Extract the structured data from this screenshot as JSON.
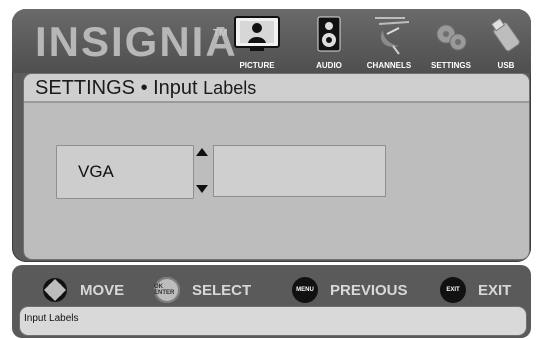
{
  "brand": {
    "logo_text": "INSIGNIA",
    "trademark": "TM"
  },
  "menu": {
    "tabs": [
      {
        "label": "PICTURE",
        "icon": "tv-anchor-icon"
      },
      {
        "label": "AUDIO",
        "icon": "speaker-icon"
      },
      {
        "label": "CHANNELS",
        "icon": "satellite-dish-icon"
      },
      {
        "label": "SETTINGS",
        "icon": "gears-icon",
        "active": true
      },
      {
        "label": "USB",
        "icon": "usb-stick-icon"
      }
    ]
  },
  "screen": {
    "title": "SETTINGS • Input",
    "title_sub": "Labels",
    "input_name": "VGA",
    "label_value": ""
  },
  "footer": {
    "hints": [
      {
        "label": "MOVE",
        "icon": "dpad-icon"
      },
      {
        "label": "SELECT",
        "icon": "ok-enter-icon",
        "icon_text": "OK ENTER"
      },
      {
        "label": "PREVIOUS",
        "icon": "menu-button-icon",
        "icon_text": "MENU"
      },
      {
        "label": "EXIT",
        "icon": "exit-button-icon",
        "icon_text": "EXIT"
      }
    ],
    "info_text": "Input Labels"
  }
}
